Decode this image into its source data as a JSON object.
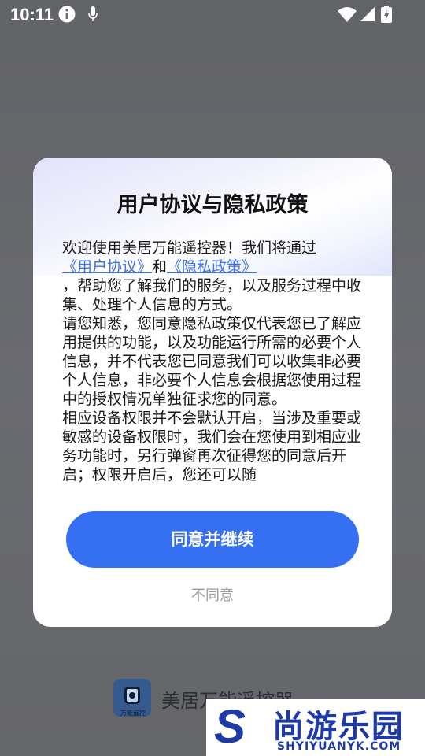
{
  "status_bar": {
    "time": "10:11",
    "icons": [
      "info-icon",
      "mic-icon",
      "wifi-icon",
      "signal-icon",
      "battery-icon"
    ]
  },
  "background_app": {
    "logo_text": "万能遥控",
    "name": "美居万能遥控器"
  },
  "dialog": {
    "title": "用户协议与隐私政策",
    "body": {
      "intro": "欢迎使用美居万能遥控器！我们将通过",
      "user_agreement_link": "《用户协议》",
      "and": "和",
      "privacy_policy_link": "《隐私政策》",
      "intro_rest": "，帮助您了解我们的服务，以及服务过程中收集、处理个人信息的方式。",
      "para2": "请您知悉，您同意隐私政策仅代表您已了解应用提供的功能，以及功能运行所需的必要个人信息，并不代表您已同意我们可以收集非必要个人信息，非必要个人信息会根据您使用过程中的授权情况单独征求您的同意。",
      "para3": "相应设备权限并不会默认开启，当涉及重要或敏感的设备权限时，我们会在您使用到相应业务功能时，另行弹窗再次征得您的同意后开启；权限开启后，您还可以随"
    },
    "agree_label": "同意并继续",
    "disagree_label": "不同意"
  },
  "watermark": {
    "letter": "S",
    "name": "尚游乐园",
    "url": "SHYIYUANYK.COM"
  },
  "colors": {
    "accent": "#3670f2",
    "link": "#3a6ff2",
    "watermark": "#1e3aa8"
  }
}
